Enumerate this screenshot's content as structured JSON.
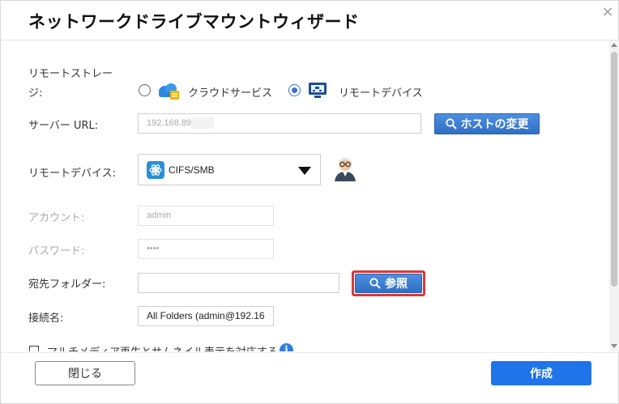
{
  "dialog": {
    "title": "ネットワークドライブマウントウィザード",
    "close_glyph": "×"
  },
  "form": {
    "remote_storage": {
      "label_line1": "リモートストレー",
      "label_line2": "ジ:",
      "options": [
        {
          "label": "クラウドサービス",
          "selected": false,
          "icon": "cloud-service-icon"
        },
        {
          "label": "リモートデバイス",
          "selected": true,
          "icon": "remote-device-icon"
        }
      ]
    },
    "server_url": {
      "label": "サーバー URL:",
      "value": "192.168.89",
      "change_host_label": "ホストの変更"
    },
    "remote_device": {
      "label": "リモートデバイス:",
      "selected": "CIFS/SMB"
    },
    "account": {
      "label": "アカウント:",
      "value": "admin"
    },
    "password": {
      "label": "パスワード:",
      "value": "••••"
    },
    "destination_folder": {
      "label": "宛先フォルダー:",
      "value": "",
      "browse_label": "参照"
    },
    "connection_name": {
      "label": "接続名:",
      "value": "All Folders (admin@192.16"
    },
    "multimedia": {
      "label": "マルチメディア再生とサムネイル表示を対応する",
      "checked": false
    }
  },
  "footer": {
    "close_label": "閉じる",
    "create_label": "作成"
  },
  "colors": {
    "accent": "#1e74e8",
    "highlight": "#d63a3a"
  }
}
